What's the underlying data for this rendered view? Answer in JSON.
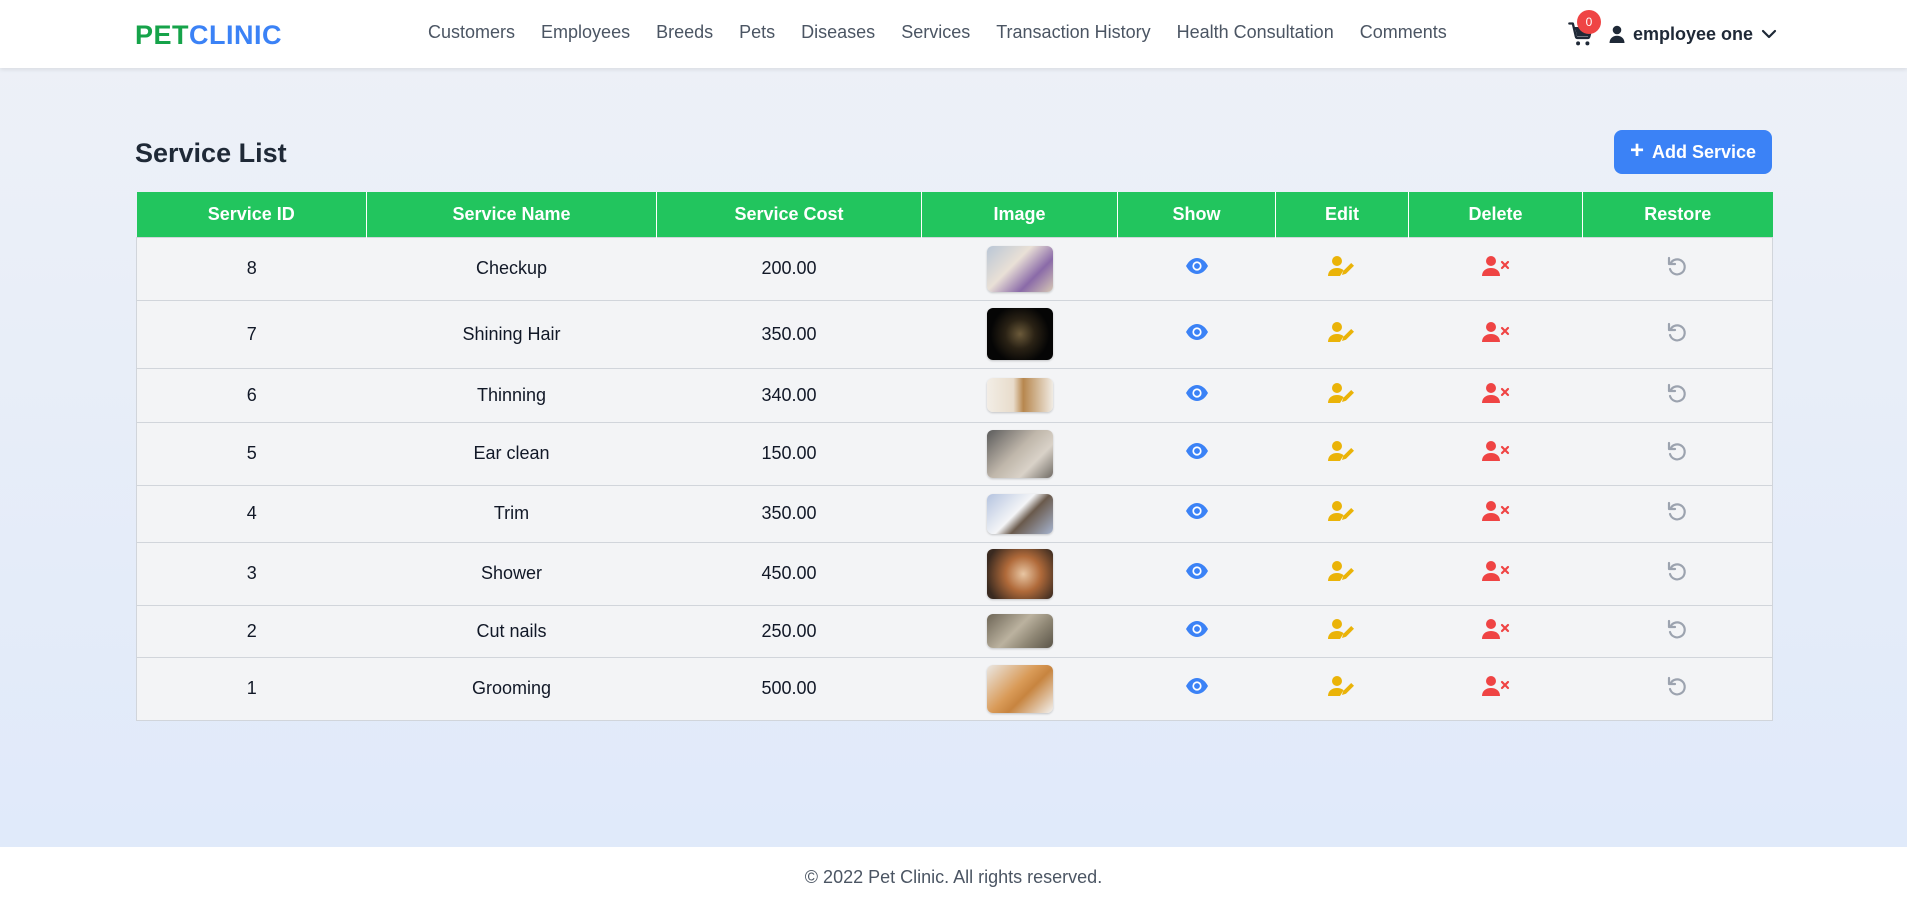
{
  "brand": {
    "part1": "PET",
    "part2": "CLINIC"
  },
  "nav": [
    "Customers",
    "Employees",
    "Breeds",
    "Pets",
    "Diseases",
    "Services",
    "Transaction History",
    "Health Consultation",
    "Comments"
  ],
  "cart": {
    "count": "0",
    "icon": "cart-icon"
  },
  "user": {
    "name": "employee one",
    "icon": "user-icon",
    "caret": "chevron-down-icon"
  },
  "page": {
    "title": "Service List",
    "add_label": "Add Service"
  },
  "table": {
    "headers": [
      "Service ID",
      "Service Name",
      "Service Cost",
      "Image",
      "Show",
      "Edit",
      "Delete",
      "Restore"
    ],
    "rows": [
      {
        "id": "8",
        "name": "Checkup",
        "cost": "200.00"
      },
      {
        "id": "7",
        "name": "Shining Hair",
        "cost": "350.00"
      },
      {
        "id": "6",
        "name": "Thinning",
        "cost": "340.00"
      },
      {
        "id": "5",
        "name": "Ear clean",
        "cost": "150.00"
      },
      {
        "id": "4",
        "name": "Trim",
        "cost": "350.00"
      },
      {
        "id": "3",
        "name": "Shower",
        "cost": "450.00"
      },
      {
        "id": "2",
        "name": "Cut nails",
        "cost": "250.00"
      },
      {
        "id": "1",
        "name": "Grooming",
        "cost": "500.00"
      }
    ]
  },
  "colors": {
    "brand_green": "#16a34a",
    "brand_blue": "#3b82f6",
    "header_green": "#22c55e",
    "show": "#3b82f6",
    "edit": "#eab308",
    "delete": "#ef4444",
    "restore": "#9ca3af"
  },
  "footer": {
    "text": "© 2022 Pet Clinic. All rights reserved."
  }
}
